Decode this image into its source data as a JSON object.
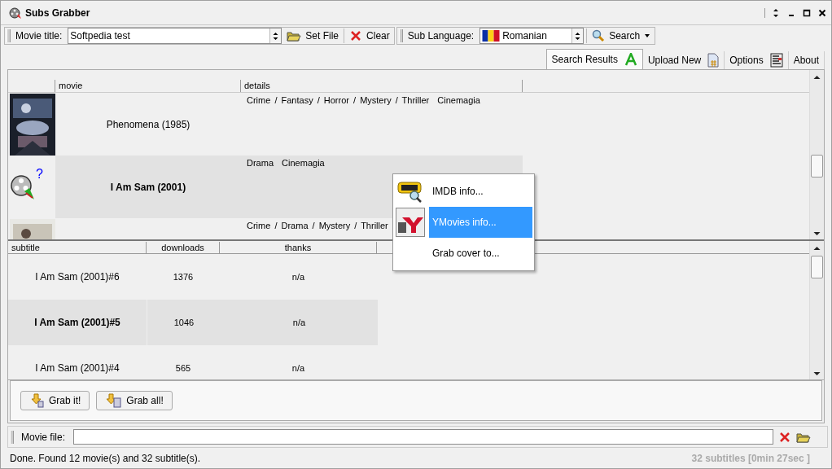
{
  "window": {
    "title": "Subs Grabber"
  },
  "toolbar": {
    "movie_title_label": "Movie title:",
    "movie_title": "Softpedia test",
    "set_file": "Set File",
    "clear": "Clear",
    "sub_language_label": "Sub Language:",
    "sub_language": "Romanian",
    "search": "Search"
  },
  "tabs": [
    {
      "label": "Search Results",
      "selected": true
    },
    {
      "label": "Upload New",
      "selected": false
    },
    {
      "label": "Options",
      "selected": false
    },
    {
      "label": "About",
      "selected": false
    }
  ],
  "movies": {
    "columns": [
      "movie",
      "details"
    ],
    "rows": [
      {
        "kind": "picture",
        "title": "Phenomena (1985)",
        "details": "Crime / Fantasy / Horror / Mystery / Thriller  Cinemagia",
        "selected": false
      },
      {
        "kind": "icon",
        "poster_mark": "?",
        "title": "I Am Sam (2001)",
        "details": "Drama  Cinemagia",
        "selected": true
      },
      {
        "kind": "picture",
        "details": "Crime / Drama / Mystery / Thriller",
        "selected": false
      }
    ]
  },
  "context_menu": [
    {
      "label": "IMDB info...",
      "selected": false
    },
    {
      "label": "YMovies info...",
      "selected": true
    },
    {
      "label": "Grab cover to...",
      "selected": false
    }
  ],
  "subtitles": {
    "columns": [
      "subtitle",
      "downloads",
      "thanks"
    ],
    "rows": [
      {
        "subtitle": "I Am Sam (2001)#6",
        "downloads": "1376",
        "thanks": "n/a",
        "selected": false
      },
      {
        "subtitle": "I Am Sam (2001)#5",
        "downloads": "1046",
        "thanks": "n/a",
        "selected": true
      },
      {
        "subtitle": "I Am Sam (2001)#4",
        "downloads": "565",
        "thanks": "n/a",
        "selected": false
      }
    ]
  },
  "buttons": [
    "Grab it!",
    "Grab all!"
  ],
  "movie_file": {
    "label": "Movie file:"
  },
  "status_bar": {
    "message": "Done. Found 12 movie(s) and 32 subtitle(s).",
    "summary": "32 subtitles  [0min 27sec ]"
  }
}
